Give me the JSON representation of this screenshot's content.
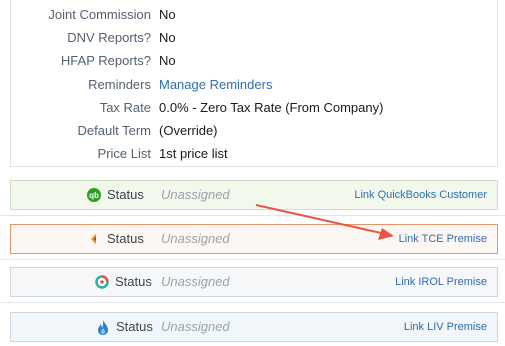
{
  "properties": [
    {
      "label": "Joint Commission",
      "value": "No",
      "is_link": false
    },
    {
      "label": "DNV Reports?",
      "value": "No",
      "is_link": false
    },
    {
      "label": "HFAP Reports?",
      "value": "No",
      "is_link": false
    },
    {
      "label": "Reminders",
      "value": "Manage Reminders",
      "is_link": true
    },
    {
      "label": "Tax Rate",
      "value": "0.0% - Zero Tax Rate (From Company)",
      "is_link": false
    },
    {
      "label": "Default Term",
      "value": "(Override)",
      "is_link": false
    },
    {
      "label": "Price List",
      "value": "1st price list",
      "is_link": false
    }
  ],
  "integrations": [
    {
      "icon": "quickbooks-icon",
      "status_label": "Status",
      "status_value": "Unassigned",
      "link": "Link QuickBooks Customer",
      "background": "#f2f9ec",
      "border": "#cfdcc6"
    },
    {
      "icon": "tce-icon",
      "status_label": "Status",
      "status_value": "Unassigned",
      "link": "Link TCE Premise",
      "background": "#fdf7f3",
      "border": "#e8956b"
    },
    {
      "icon": "irol-icon",
      "status_label": "Status",
      "status_value": "Unassigned",
      "link": "Link IROL Premise",
      "background": "#f5f7f9",
      "border": "#cfd6dd"
    },
    {
      "icon": "liv-icon",
      "status_label": "Status",
      "status_value": "Unassigned",
      "link": "Link LIV Premise",
      "background": "#f1f6fb",
      "border": "#cfd6dd"
    }
  ],
  "colors": {
    "link": "#2f6db5",
    "annotation_arrow": "#e8564a",
    "quickbooks_green": "#2ca01c"
  }
}
